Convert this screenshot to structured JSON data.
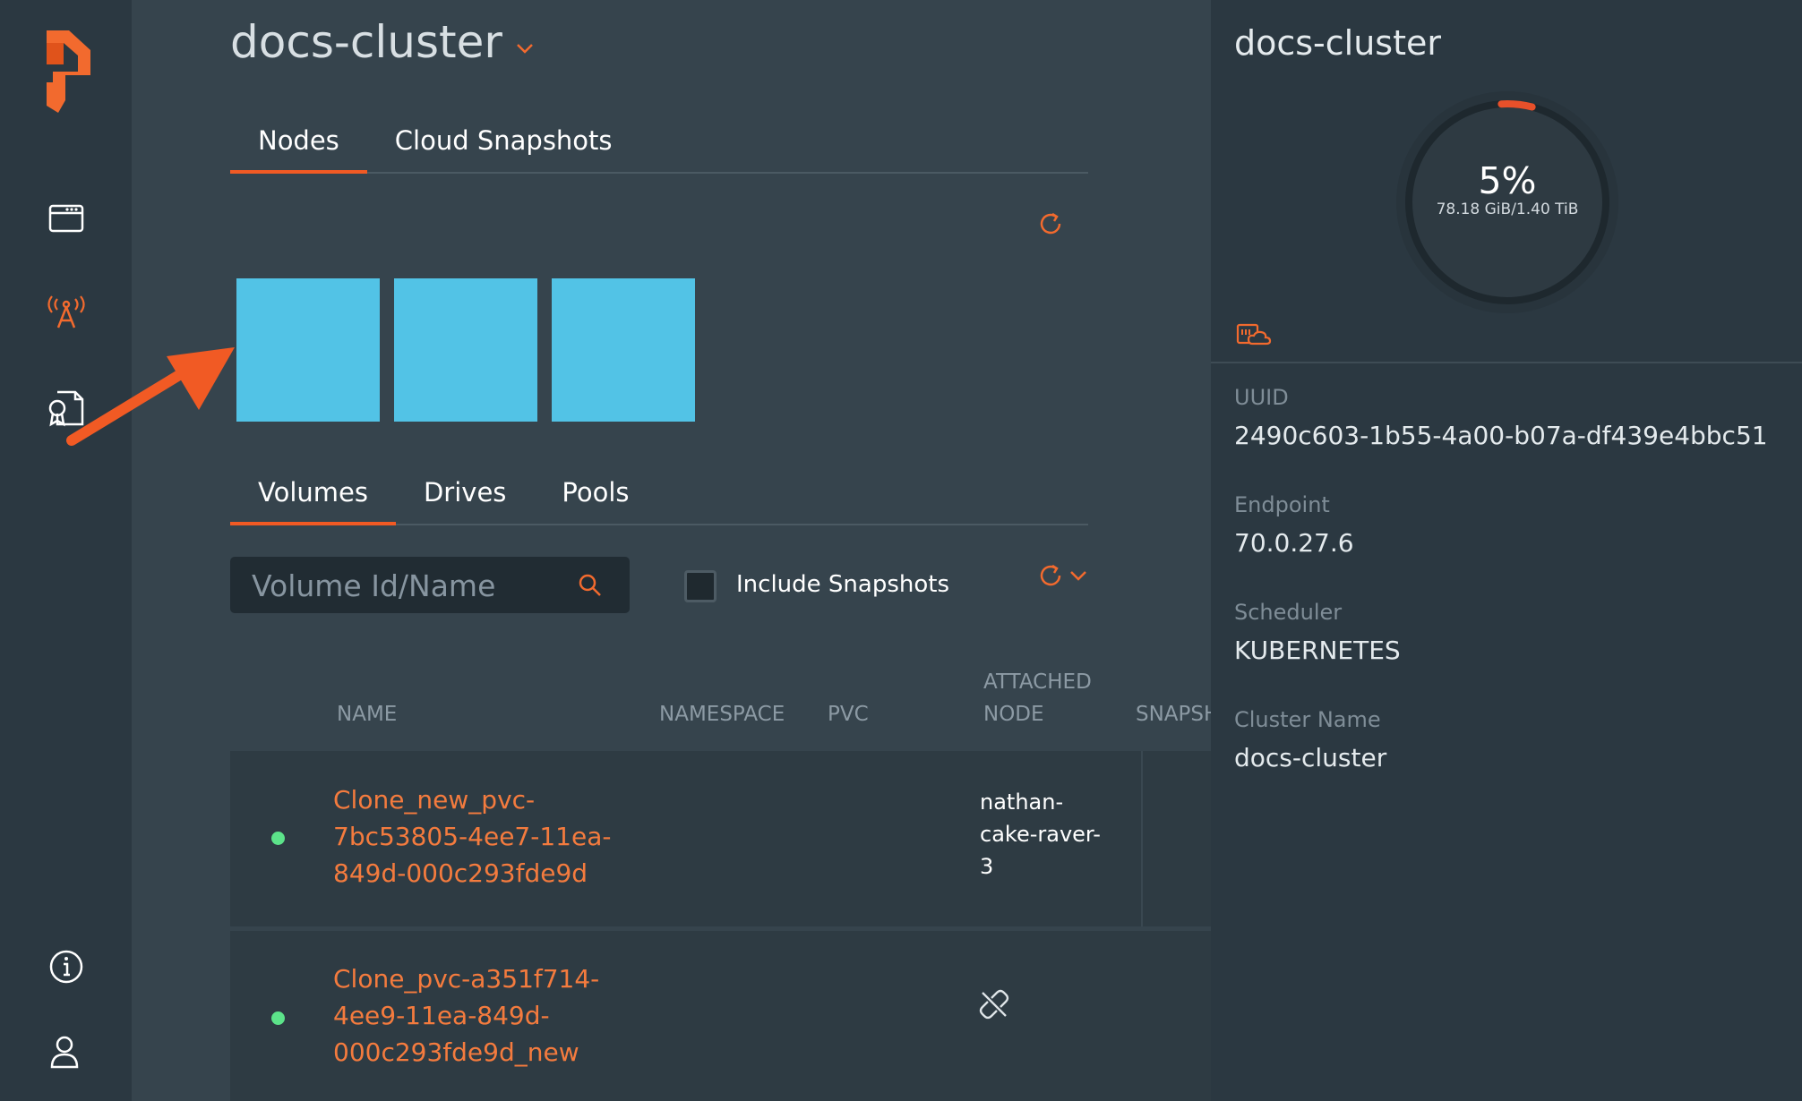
{
  "cluster": {
    "name": "docs-cluster"
  },
  "top_tabs": [
    {
      "label": "Nodes",
      "active": true
    },
    {
      "label": "Cloud Snapshots",
      "active": false
    }
  ],
  "nodes": {
    "count": 3,
    "tile_color": "#52c3e6"
  },
  "sub_tabs": [
    {
      "label": "Volumes",
      "active": true
    },
    {
      "label": "Drives",
      "active": false
    },
    {
      "label": "Pools",
      "active": false
    }
  ],
  "search": {
    "placeholder": "Volume Id/Name"
  },
  "include_snapshots": {
    "label": "Include Snapshots",
    "checked": false
  },
  "table": {
    "columns": {
      "name": "NAME",
      "namespace": "NAMESPACE",
      "pvc": "PVC",
      "attached_node_line1": "ATTACHED",
      "attached_node_line2": "NODE",
      "snapshots": "SNAPSH"
    },
    "rows": [
      {
        "status": "online",
        "name_lines": [
          "Clone_new_pvc-",
          "7bc53805-4ee7-11ea-",
          "849d-000c293fde9d"
        ],
        "attached_node_lines": [
          "nathan-",
          "cake-raver-",
          "3"
        ]
      },
      {
        "status": "online",
        "name_lines": [
          "Clone_pvc-a351f714-",
          "4ee9-11ea-849d-",
          "000c293fde9d_new"
        ],
        "attached_node_lines": [],
        "detached_icon": "unlink-icon"
      }
    ]
  },
  "summary": {
    "title": "docs-cluster",
    "usage": {
      "percent_label": "5%",
      "percent": 5,
      "capacity_label": "78.18 GiB/1.40 TiB"
    },
    "properties": [
      {
        "label": "UUID",
        "value": "2490c603-1b55-4a00-b07a-df439e4bbc51"
      },
      {
        "label": "Endpoint",
        "value": "70.0.27.6"
      },
      {
        "label": "Scheduler",
        "value": "KUBERNETES"
      },
      {
        "label": "Cluster Name",
        "value": "docs-cluster"
      }
    ]
  },
  "colors": {
    "accent": "#f15a24",
    "link": "#f47b3e",
    "status_online": "#5ce38a"
  }
}
